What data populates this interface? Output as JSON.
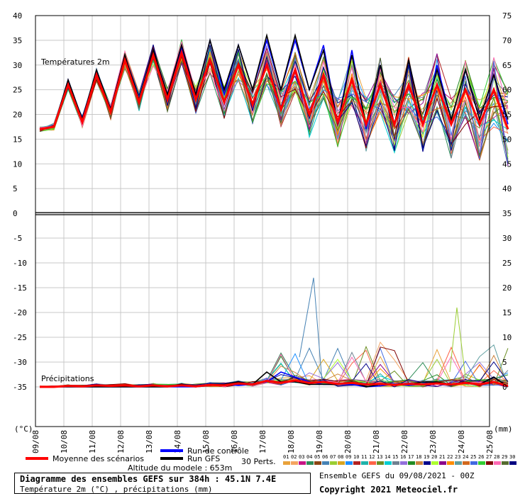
{
  "chart_data": {
    "type": "line",
    "temp_panel": {
      "label": "Températures 2m",
      "y_left_ticks": [
        "40",
        "35",
        "30",
        "25",
        "20",
        "15",
        "10",
        "5",
        "0"
      ],
      "y_right_ticks": [
        "75",
        "70",
        "65",
        "60",
        "55",
        "50",
        "45",
        "40",
        "35"
      ],
      "ylim": [
        0,
        40
      ],
      "control": [
        17,
        17.5,
        27,
        19,
        28.5,
        21,
        31,
        23,
        33,
        24,
        33.5,
        24,
        35,
        24,
        34,
        25,
        35,
        25,
        35,
        25,
        34,
        18,
        33,
        17,
        30,
        18,
        31,
        18,
        30,
        19,
        29,
        19,
        28,
        18
      ],
      "gfs": [
        17,
        17.5,
        27,
        19,
        29,
        21,
        32,
        23,
        33,
        24,
        34,
        24,
        35,
        25,
        34,
        25,
        36,
        25,
        36,
        25,
        33,
        18,
        32,
        18,
        30,
        18,
        31,
        18,
        29,
        19,
        29,
        19,
        28,
        19
      ],
      "mean": [
        17,
        17.5,
        26,
        18.5,
        28,
        20.5,
        31,
        22.5,
        32,
        23,
        32.5,
        23,
        31,
        22.5,
        30,
        22,
        30,
        21,
        29,
        20,
        28,
        18.5,
        27,
        18,
        26,
        18,
        26,
        18,
        26,
        18,
        25,
        18,
        25,
        17
      ]
    },
    "precip_panel": {
      "label": "Précipitations",
      "y_left_ticks": [
        "0",
        "-5",
        "-10",
        "-15",
        "-20",
        "-25",
        "-30",
        "-35"
      ],
      "y_right_ticks": [
        "35",
        "30",
        "25",
        "20",
        "15",
        "10",
        "5",
        "0"
      ],
      "ylim": [
        0,
        35
      ],
      "control": [
        0,
        0,
        0,
        0,
        0,
        0,
        0,
        0,
        0,
        0,
        0,
        0,
        0.3,
        0.5,
        0.3,
        0.5,
        1,
        3,
        2,
        1,
        0.5,
        0.5,
        0.5,
        0,
        0.2,
        0.5,
        0.3,
        0.5,
        0.8,
        0.5,
        1,
        0.5,
        2,
        0
      ],
      "gfs": [
        0,
        0,
        0,
        0,
        0,
        0,
        0,
        0,
        0,
        0,
        0.5,
        0,
        0.5,
        0.5,
        1,
        0.5,
        3,
        1,
        1,
        0.5,
        0.5,
        0.5,
        1,
        0,
        0.5,
        0.5,
        0.5,
        1,
        1,
        0.5,
        1,
        0.5,
        2,
        0
      ],
      "mean": [
        0,
        0,
        0.2,
        0.1,
        0.3,
        0.2,
        0.3,
        0.1,
        0.3,
        0.1,
        0.3,
        0.1,
        0.4,
        0.3,
        0.7,
        0.5,
        1.2,
        0.8,
        1.3,
        0.8,
        1.0,
        0.6,
        0.8,
        0.5,
        0.6,
        0.4,
        0.6,
        0.5,
        0.7,
        0.5,
        0.8,
        0.5,
        1.0,
        0.2
      ],
      "peak_line_x": 19.6,
      "peak_line_val": 22
    },
    "x_ticks": [
      "09/08",
      "10/08",
      "11/08",
      "12/08",
      "13/08",
      "14/08",
      "15/08",
      "16/08",
      "17/08",
      "18/08",
      "19/08",
      "20/08",
      "21/08",
      "22/08",
      "23/08",
      "24/08",
      "25/08"
    ],
    "x_unit_left": "(°C)",
    "x_unit_right": "(mm)",
    "ens_colors": [
      "#e9a23b",
      "#f4a460",
      "#c71585",
      "#2e8b57",
      "#8b4513",
      "#4682b4",
      "#9acd32",
      "#daa520",
      "#1e90ff",
      "#b22222",
      "#20b2aa",
      "#ff6347",
      "#6b8e23",
      "#00ced1",
      "#708090",
      "#9370db",
      "#228b22",
      "#cd853f",
      "#00008b",
      "#adff2f",
      "#8b008b",
      "#ff8c00",
      "#5f9ea0",
      "#d2691e",
      "#4169e1",
      "#32cd32",
      "#800000",
      "#ff69b4",
      "#556b2f",
      "#000080"
    ]
  },
  "legend": {
    "control": "Run de contrôle",
    "gfs": "Run GFS",
    "mean": "Moyenne des scénarios",
    "perts": "30 Perts.",
    "altitude": "Altitude du modele : 653m",
    "pert_numbers": [
      "01",
      "02",
      "03",
      "04",
      "05",
      "06",
      "07",
      "08",
      "09",
      "10",
      "11",
      "12",
      "13",
      "14",
      "15",
      "16",
      "17",
      "18",
      "19",
      "20",
      "21",
      "22",
      "23",
      "24",
      "25",
      "26",
      "27",
      "28",
      "29",
      "30"
    ],
    "colors": {
      "control": "#0000ff",
      "gfs": "#000000",
      "mean": "#ff0000"
    }
  },
  "footer": {
    "title": "Diagramme des ensembles GEFS sur 384h : 45.1N 7.4E",
    "subtitle": "Température 2m (°C) , précipitations (mm)",
    "run": "Ensemble GEFS du 09/08/2021 - 00Z",
    "copyright": "Copyright 2021 Meteociel.fr"
  }
}
